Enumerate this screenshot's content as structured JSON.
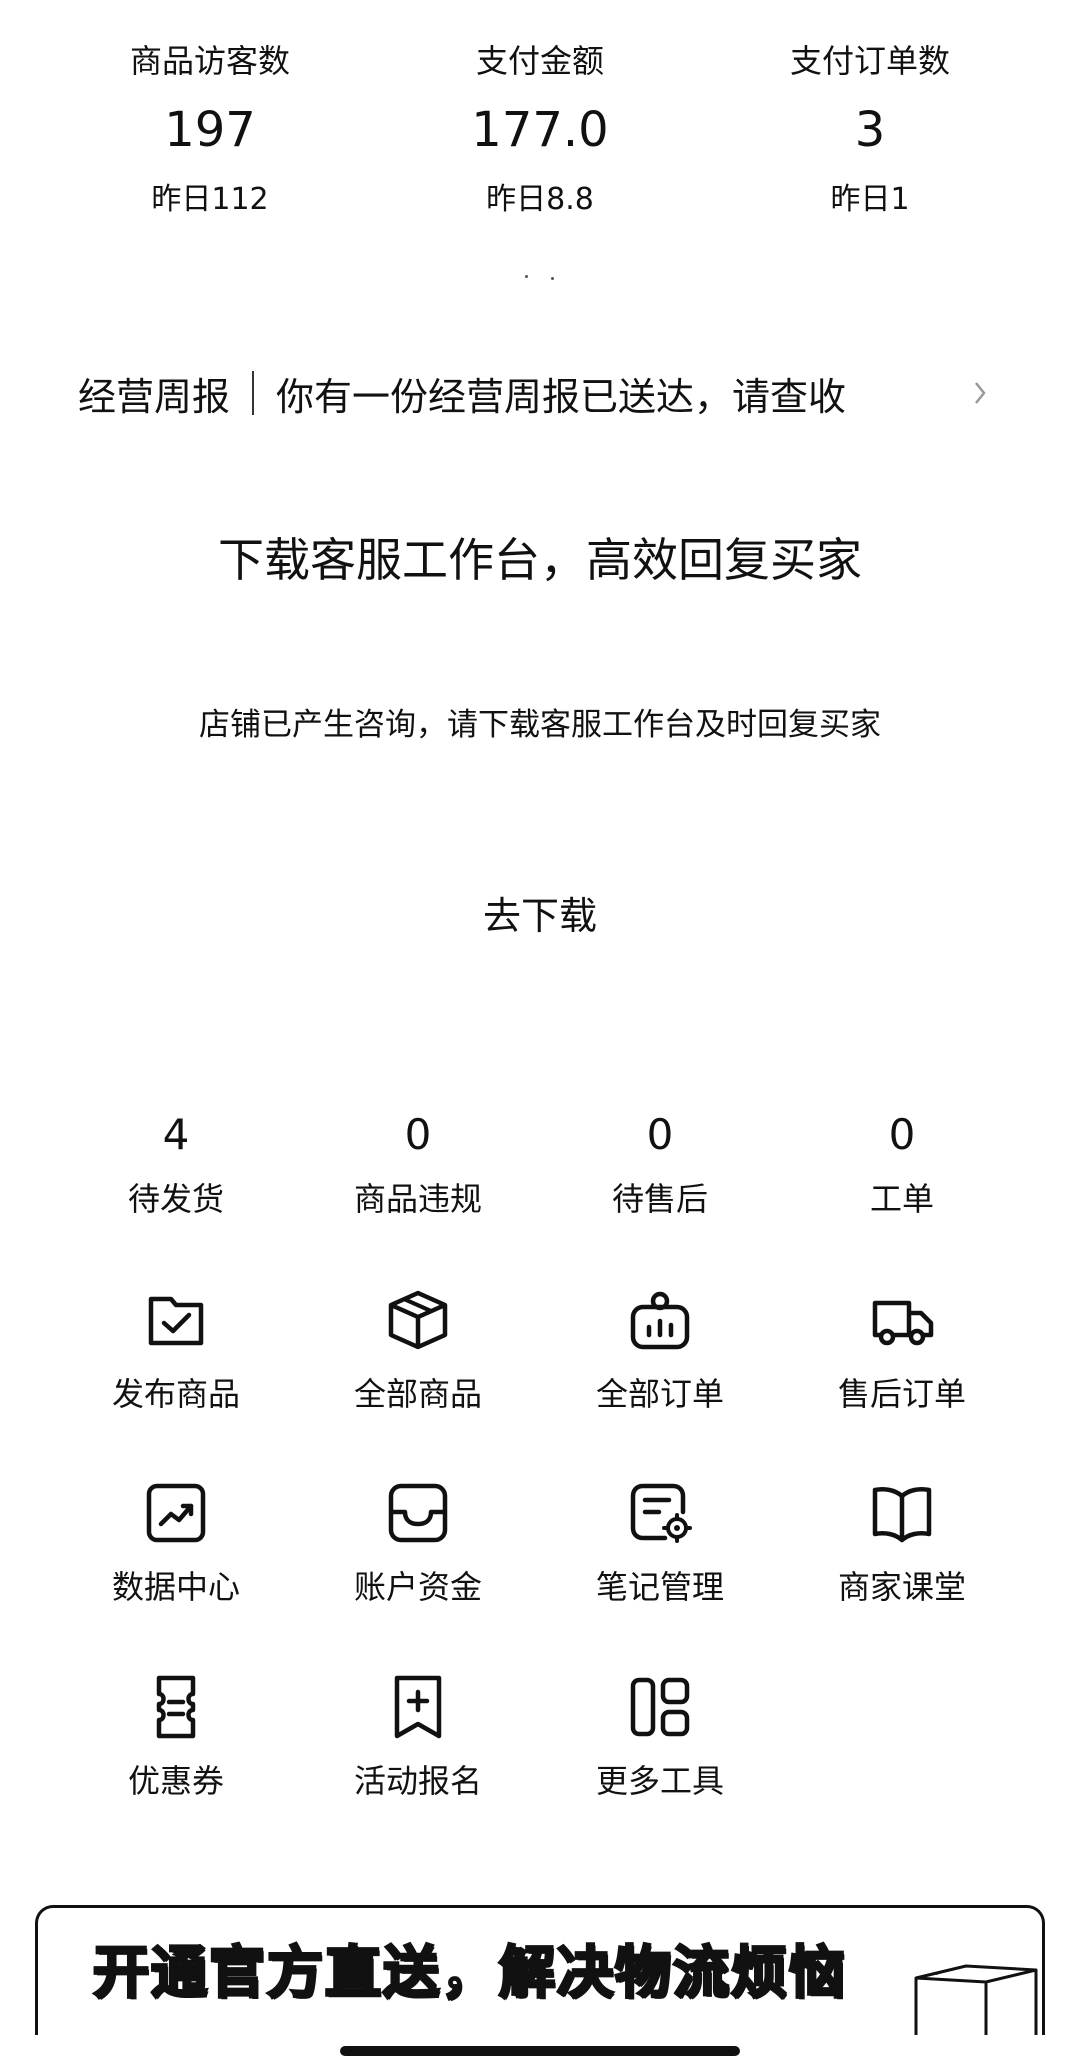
{
  "stats": [
    {
      "label": "商品访客数",
      "value": "197",
      "yesterday": "昨日112"
    },
    {
      "label": "支付金额",
      "value": "177.0",
      "yesterday": "昨日8.8"
    },
    {
      "label": "支付订单数",
      "value": "3",
      "yesterday": "昨日1"
    }
  ],
  "weekly": {
    "title": "经营周报",
    "text": "你有一份经营周报已送达，请查收"
  },
  "download": {
    "title": "下载客服工作台，高效回复买家",
    "desc": "店铺已产生咨询，请下载客服工作台及时回复买家",
    "button": "去下载"
  },
  "counters": [
    {
      "num": "4",
      "label": "待发货"
    },
    {
      "num": "0",
      "label": "商品违规"
    },
    {
      "num": "0",
      "label": "待售后"
    },
    {
      "num": "0",
      "label": "工单"
    }
  ],
  "tools": [
    {
      "label": "发布商品",
      "icon": "folder-check-icon"
    },
    {
      "label": "全部商品",
      "icon": "box-icon"
    },
    {
      "label": "全部订单",
      "icon": "order-bag-icon"
    },
    {
      "label": "售后订单",
      "icon": "truck-icon"
    },
    {
      "label": "数据中心",
      "icon": "trend-chart-icon"
    },
    {
      "label": "账户资金",
      "icon": "wallet-tray-icon"
    },
    {
      "label": "笔记管理",
      "icon": "note-settings-icon"
    },
    {
      "label": "商家课堂",
      "icon": "book-icon"
    },
    {
      "label": "优惠券",
      "icon": "coupon-icon"
    },
    {
      "label": "活动报名",
      "icon": "bookmark-plus-icon"
    },
    {
      "label": "更多工具",
      "icon": "grid-tools-icon"
    }
  ],
  "banner": {
    "text": "开通官方直送，解决物流烦恼"
  }
}
